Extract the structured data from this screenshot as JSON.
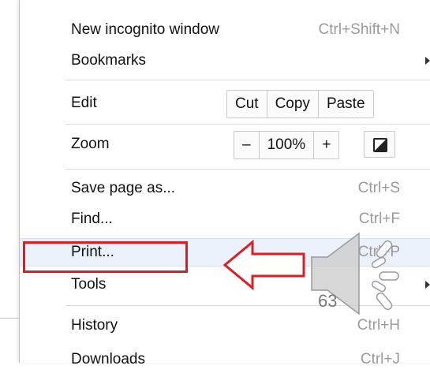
{
  "menu": {
    "items": [
      {
        "label": "New incognito window",
        "shortcut": "Ctrl+Shift+N"
      },
      {
        "label": "Bookmarks",
        "shortcut": ""
      },
      {
        "label": "Edit",
        "shortcut": ""
      },
      {
        "label": "Zoom",
        "shortcut": ""
      },
      {
        "label": "Save page as...",
        "shortcut": "Ctrl+S"
      },
      {
        "label": "Find...",
        "shortcut": "Ctrl+F"
      },
      {
        "label": "Print...",
        "shortcut": "Ctrl+P"
      },
      {
        "label": "Tools",
        "shortcut": ""
      },
      {
        "label": "History",
        "shortcut": "Ctrl+H"
      },
      {
        "label": "Downloads",
        "shortcut": "Ctrl+J"
      }
    ],
    "edit": {
      "cut": "Cut",
      "copy": "Copy",
      "paste": "Paste"
    },
    "zoom": {
      "minus": "–",
      "level": "100%",
      "plus": "+"
    }
  },
  "overlay": {
    "page_number": "63",
    "highlight_color": "#e11b22"
  }
}
